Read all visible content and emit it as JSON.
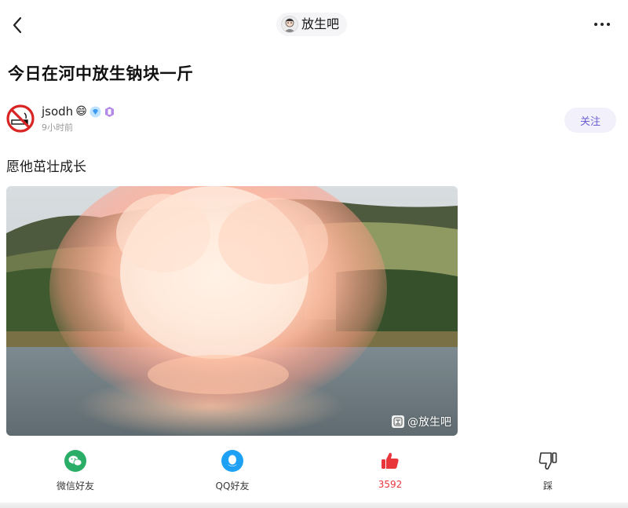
{
  "header": {
    "forum_name": "放生吧"
  },
  "post": {
    "title": "今日在河中放生钠块一斤",
    "author": {
      "name": "jsodh",
      "name_emoji": "😄",
      "time": "9小时前"
    },
    "follow_label": "关注",
    "body": "愿他茁壮成长",
    "image_watermark": "@放生吧"
  },
  "actions": [
    {
      "label": "微信好友",
      "icon": "wechat-icon"
    },
    {
      "label": "QQ好友",
      "icon": "qq-icon"
    },
    {
      "label": "3592",
      "icon": "thumbs-up-icon"
    },
    {
      "label": "踩",
      "icon": "thumbs-down-icon"
    }
  ],
  "colors": {
    "accent_follow": "#6b5fd3",
    "like_red": "#e8363b",
    "wechat_green": "#2aae67",
    "qq_blue": "#1ea0f5"
  }
}
